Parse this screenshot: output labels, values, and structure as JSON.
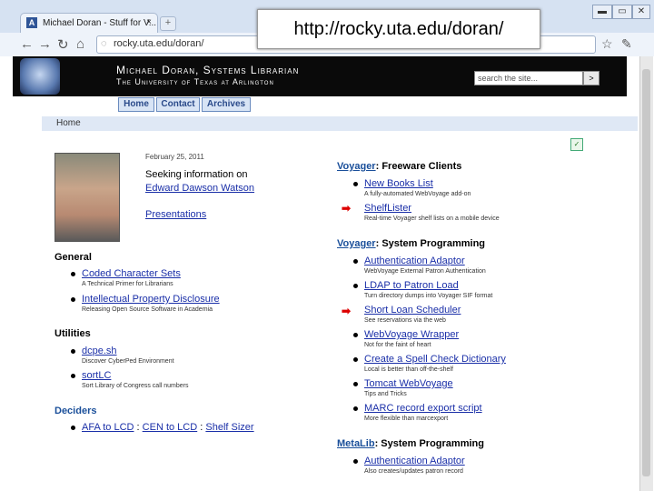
{
  "browser": {
    "tab_title": "Michael Doran - Stuff for V...",
    "tab_close": "×",
    "new_tab": "+",
    "win_min": "▬",
    "win_max": "▭",
    "win_close": "✕",
    "url": "rocky.uta.edu/doran/",
    "banner_url": "http://rocky.uta.edu/doran/"
  },
  "header": {
    "name": "Michael Doran, Systems Librarian",
    "org": "The University of Texas at Arlington",
    "search_placeholder": "search the site...",
    "go": ">"
  },
  "nav": {
    "home": "Home",
    "contact": "Contact",
    "archives": "Archives"
  },
  "breadcrumb": "Home",
  "intro": {
    "date": "February 25, 2011",
    "line1": "Seeking information on",
    "link_watson": "Edward Dawson Watson",
    "link_presentations": "Presentations"
  },
  "general": {
    "title": "General",
    "items": [
      {
        "label": "Coded Character Sets",
        "desc": "A Technical Primer for Librarians"
      },
      {
        "label": "Intellectual Property Disclosure",
        "desc": "Releasing Open Source Software in Academia"
      }
    ]
  },
  "utilities": {
    "title": "Utilities",
    "items": [
      {
        "label": "dcpe.sh",
        "desc": "Discover CyberPed Environment"
      },
      {
        "label": "sortLC",
        "desc": "Sort Library of Congress call numbers"
      }
    ]
  },
  "deciders": {
    "title": "Deciders",
    "l1": "AFA to LCD",
    "sep1": ":",
    "l2": "CEN to LCD",
    "sep2": ":",
    "l3": "Shelf Sizer"
  },
  "voyager_free": {
    "title_link": "Voyager",
    "title_rest": ": Freeware Clients",
    "items": [
      {
        "label": "New Books List",
        "desc": "A fully-automated WebVoyage add-on"
      },
      {
        "label": "ShelfLister",
        "desc": "Real-time Voyager shelf lists on a mobile device"
      }
    ]
  },
  "voyager_sys": {
    "title_link": "Voyager",
    "title_rest": ": System Programming",
    "items": [
      {
        "label": "Authentication Adaptor",
        "desc": "WebVoyage External Patron Authentication"
      },
      {
        "label": "LDAP to Patron Load",
        "desc": "Turn directory dumps into Voyager SIF format"
      },
      {
        "label": "Short Loan Scheduler",
        "desc": "See reservations via the web"
      },
      {
        "label": "WebVoyage Wrapper",
        "desc": "Not for the faint of heart"
      },
      {
        "label": "Create a Spell Check Dictionary",
        "desc": "Local is better than off-the-shelf"
      },
      {
        "label": "Tomcat WebVoyage",
        "desc": "Tips and Tricks"
      },
      {
        "label": "MARC record export script",
        "desc": "More flexible than marcexport"
      }
    ]
  },
  "metalib": {
    "title_link": "MetaLib",
    "title_rest": ": System Programming",
    "items": [
      {
        "label": "Authentication Adaptor",
        "desc": "Also creates/updates patron record"
      }
    ]
  },
  "colors": {
    "link": "#1a2fa8",
    "section_blue": "#1a4f9a",
    "arrow": "#dd0000"
  }
}
